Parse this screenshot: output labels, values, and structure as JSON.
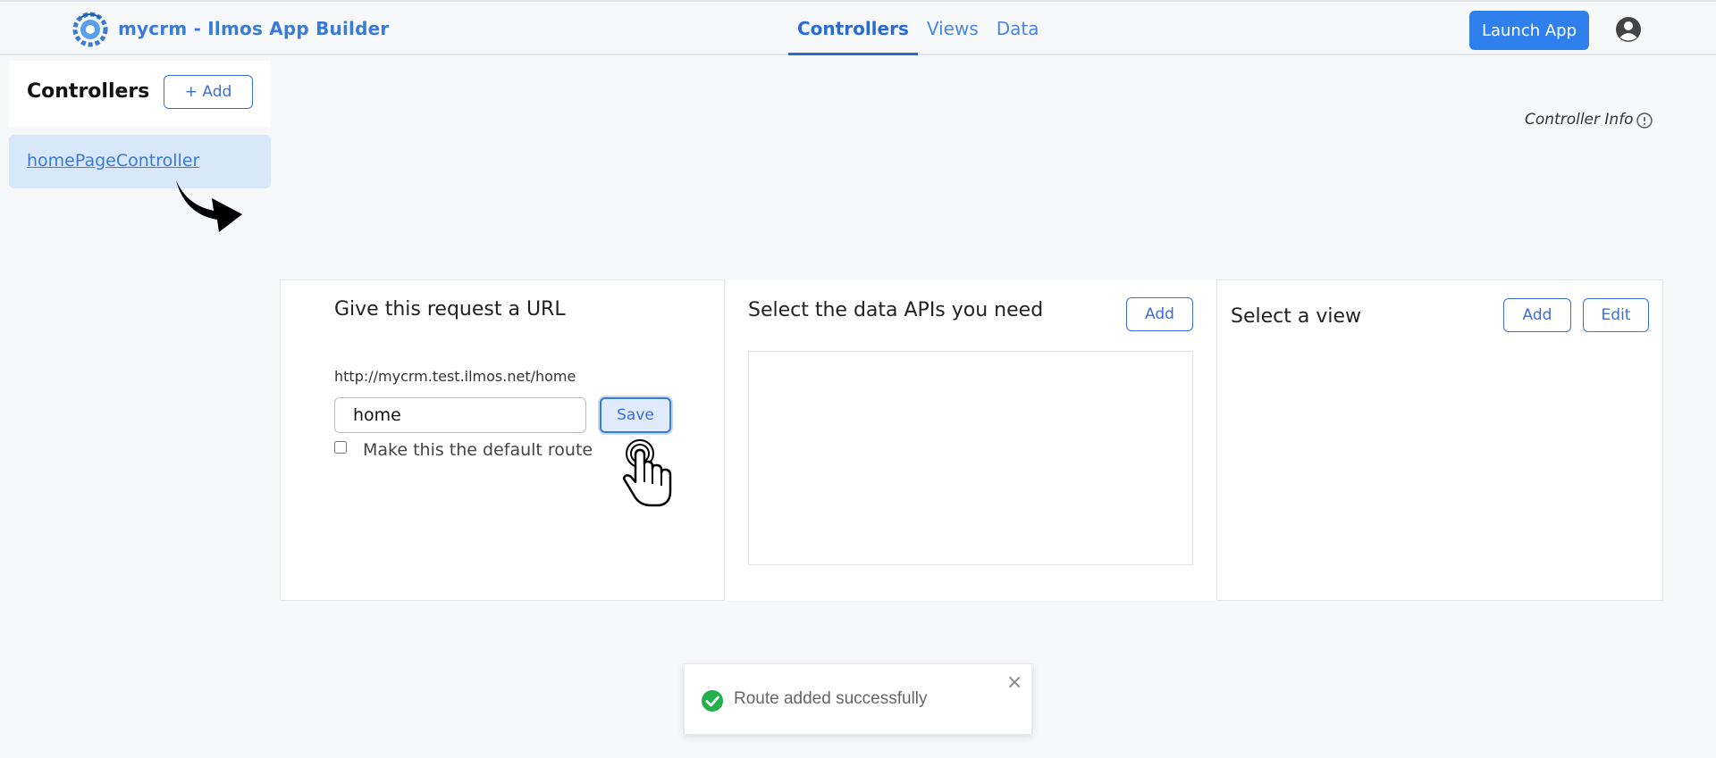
{
  "header": {
    "app_title": "mycrm - Ilmos App Builder",
    "logo_icon": "gear-logo-icon",
    "tabs": [
      {
        "label": "Controllers",
        "active": true
      },
      {
        "label": "Views",
        "active": false
      },
      {
        "label": "Data",
        "active": false
      }
    ],
    "launch_label": "Launch App",
    "accent_color": "#2f80ed"
  },
  "sidebar": {
    "title": "Controllers",
    "add_label": "+ Add",
    "items": [
      {
        "label": "homePageController",
        "selected": true
      }
    ]
  },
  "controller_info": {
    "label": "Controller Info"
  },
  "url_panel": {
    "title": "Give this request a URL",
    "url_prefix": "http://mycrm.test.ilmos.net/home",
    "route_value": "home",
    "save_label": "Save",
    "default_route_label": "Make this the default route",
    "default_route_checked": false
  },
  "api_panel": {
    "title": "Select the data APIs you need",
    "add_label": "Add"
  },
  "view_panel": {
    "title": "Select a view",
    "add_label": "Add",
    "edit_label": "Edit"
  },
  "toast": {
    "message": "Route added successfully",
    "close_glyph": "×",
    "status_color": "#22b14c"
  }
}
